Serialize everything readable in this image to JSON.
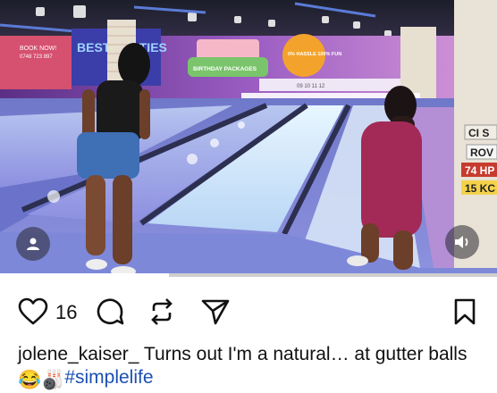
{
  "post": {
    "username": "jolene_kaiser_",
    "caption_text": "Turns out I'm a natural… at gutter balls",
    "emoji_1": "😂",
    "emoji_2": "🎳",
    "hashtag": "#simplelife",
    "like_count": "16",
    "video_progress": 0.34
  },
  "photo": {
    "sign_left": "BOOK NOW!",
    "sign_left_phone": "0748 723 897",
    "banner_big": "BEST PARTIES",
    "banner_center_title": "BIRTHDAY PACKAGES",
    "badge": "0% HASSLE 100% FUN",
    "lane_numbers": "09 10 11 12",
    "wall_signs": [
      "CI S",
      "74 HP",
      "15 KC",
      "ROV"
    ]
  },
  "icons": {
    "heart": "heart-icon",
    "comment": "comment-icon",
    "share": "repost-icon",
    "send": "send-icon",
    "save": "bookmark-icon",
    "tag": "user-tag-icon",
    "sound": "speaker-icon"
  },
  "colors": {
    "hashtag": "#1b4fb3",
    "lane_glow": "#bfe6ff",
    "wall_purple": "#7a3fa8"
  }
}
